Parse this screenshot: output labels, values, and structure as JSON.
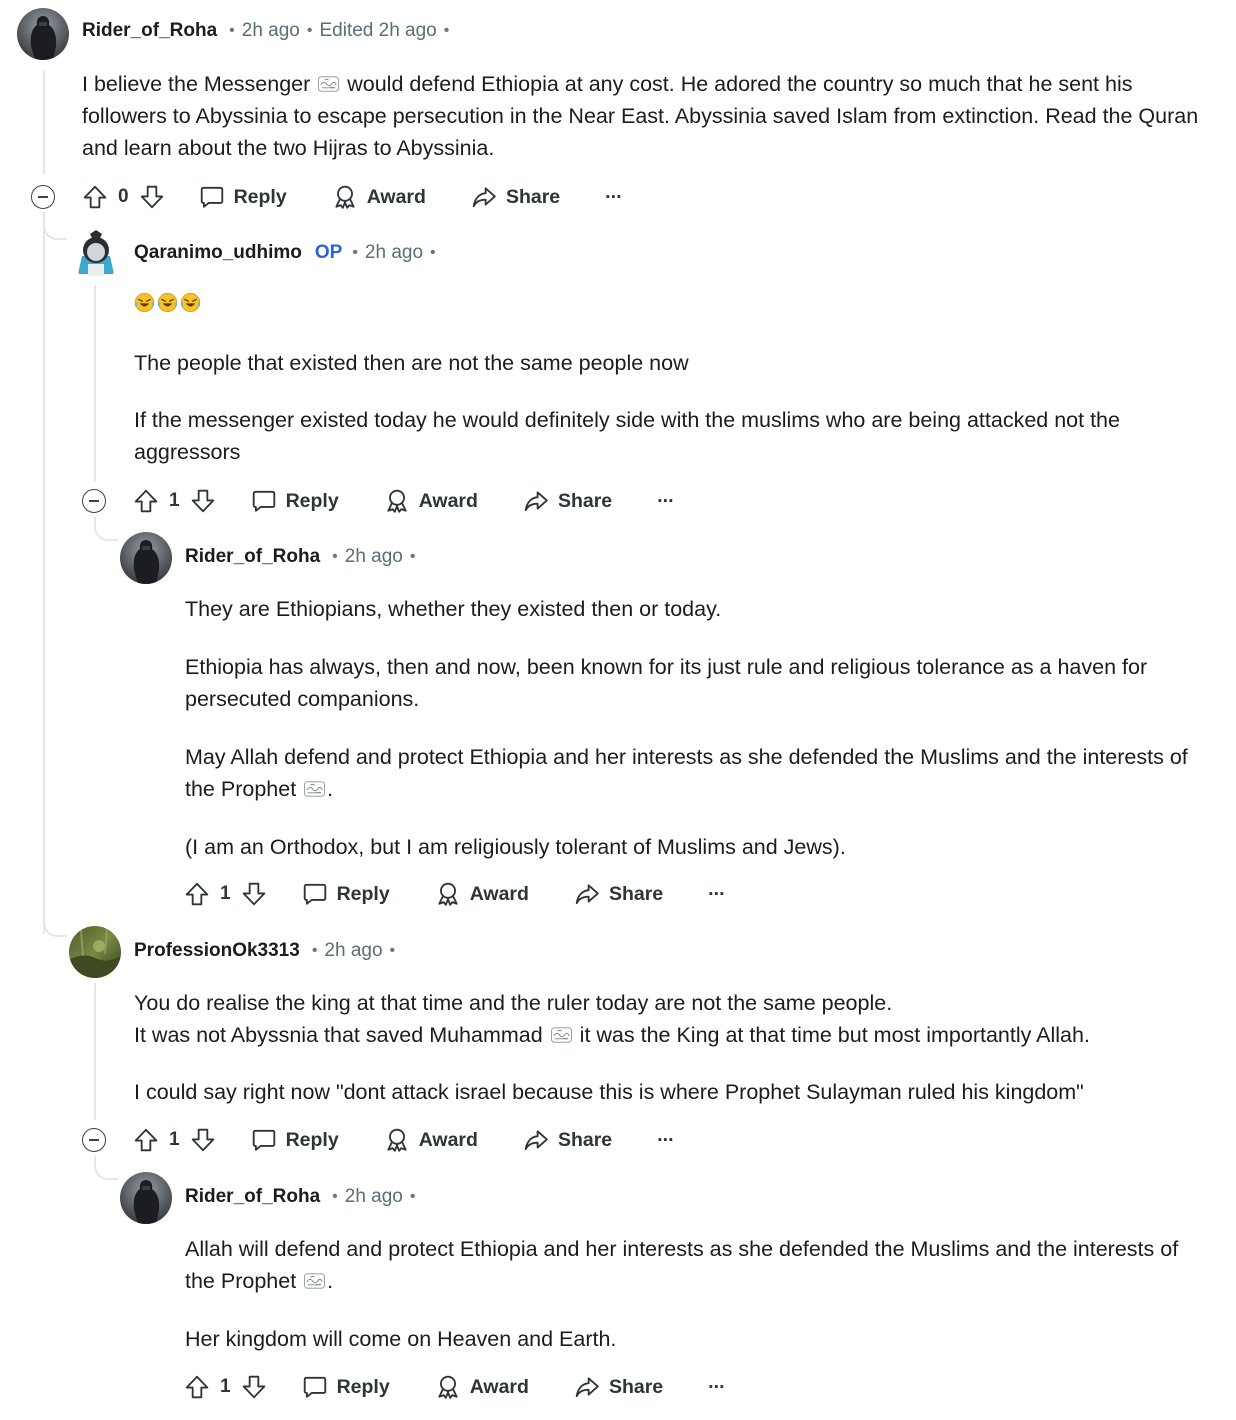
{
  "icons": {
    "upvote": "arrow-up-outline-icon",
    "downvote": "arrow-down-outline-icon",
    "reply": "speech-bubble-icon",
    "award": "award-ribbon-icon",
    "share": "share-arrow-icon",
    "more": "ellipsis-icon",
    "collapse": "minus-circle-icon",
    "honorific": "salawat-glyph-icon"
  },
  "colors": {
    "op_badge": "#2a62d8",
    "thread_line": "#e2e7e9",
    "text": "#1c1c1c",
    "meta": "#576f76"
  },
  "actions": {
    "reply": "Reply",
    "award": "Award",
    "share": "Share",
    "more": "···"
  },
  "comments": [
    {
      "user": "Rider_of_Roha",
      "time": "2h ago",
      "edited": "Edited 2h ago",
      "body": {
        "t1": "I believe the Messenger",
        "t2": " would defend Ethiopia at any cost. He adored the country so much that he sent his followers to Abyssinia to escape persecution in the Near East. Abyssinia saved Islam from extinction. Read the Quran and learn about the two Hijras to Abyssinia."
      },
      "votes": "0"
    },
    {
      "user": "Qaranimo_udhimo",
      "badge": "OP",
      "time": "2h ago",
      "emojis": [
        "rolling-on-floor-laughing",
        "rolling-on-floor-laughing",
        "rolling-on-floor-laughing"
      ],
      "body": {
        "p1": "The people that existed then are not the same people now",
        "p2": "If the messenger existed today he would definitely side with the muslims who are being attacked not the aggressors"
      },
      "votes": "1"
    },
    {
      "user": "Rider_of_Roha",
      "time": "2h ago",
      "body": {
        "p1": "They are Ethiopians, whether they existed then or today.",
        "p2": "Ethiopia has always, then and now, been known for its just rule and religious tolerance as a haven for persecuted companions.",
        "p3a": "May Allah defend and protect Ethiopia and her interests as she defended the Muslims and the interests of the Prophet",
        "p3b": ".",
        "p4": "(I am an Orthodox, but I am religiously tolerant of Muslims and Jews)."
      },
      "votes": "1"
    },
    {
      "user": "ProfessionOk3313",
      "time": "2h ago",
      "body": {
        "l1": "You do realise the king at that time and the ruler today are not the same people.",
        "l2a": "It was not Abyssnia that saved Muhammad",
        "l2b": " it was the King at that time but most importantly Allah.",
        "p2": "I could say right now \"dont attack israel because this is where Prophet Sulayman ruled his kingdom\""
      },
      "votes": "1"
    },
    {
      "user": "Rider_of_Roha",
      "time": "2h ago",
      "body": {
        "p1a": "Allah will defend and protect Ethiopia and her interests as she defended the Muslims and the interests of the Prophet",
        "p1b": ".",
        "p2": "Her kingdom will come on Heaven and Earth."
      },
      "votes": "1"
    }
  ]
}
